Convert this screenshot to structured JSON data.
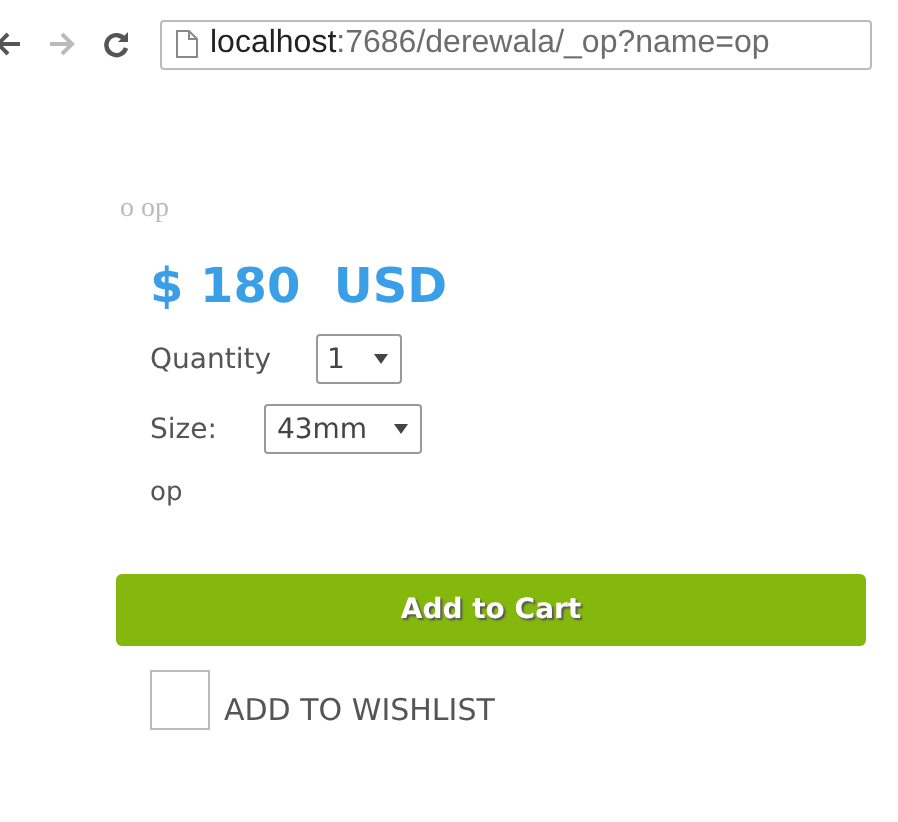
{
  "browser": {
    "url_host": "localhost",
    "url_path": ":7686/derewala/_op?name=op"
  },
  "product": {
    "title": "o op",
    "price": "$ 180  USD",
    "quantity_label": "Quantity",
    "quantity": "1",
    "size_label": "Size:",
    "size": "43mm",
    "note": "op",
    "add_button": "Add to Cart",
    "wishlist": {
      "label": "ADD TO WISHLIST",
      "checked": false
    }
  }
}
